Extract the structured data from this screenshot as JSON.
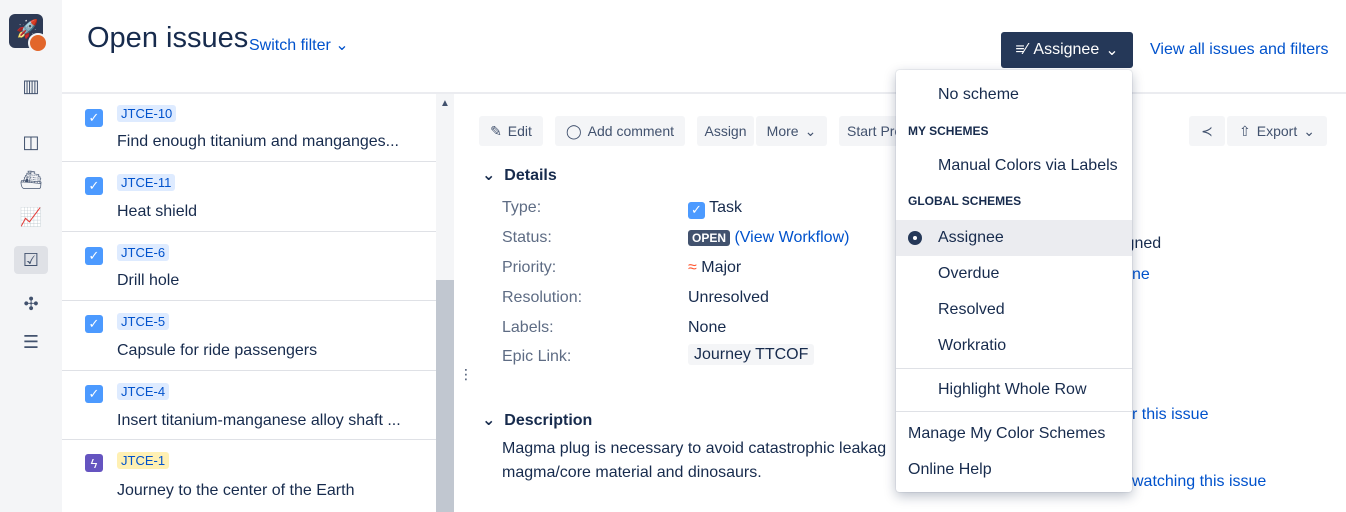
{
  "header": {
    "title": "Open issues",
    "switch_filter": "Switch filter",
    "assignee_button": "Assignee",
    "view_all": "View all issues and filters"
  },
  "nav": {
    "icons": [
      "app-logo-icon",
      "board-icon",
      "columns-icon",
      "ship-icon",
      "chart-icon",
      "issues-icon",
      "puzzle-icon",
      "checklist-icon"
    ]
  },
  "issues": [
    {
      "key": "JTCE-10",
      "summary": "Find enough titanium and manganges...",
      "type": "task"
    },
    {
      "key": "JTCE-11",
      "summary": "Heat shield",
      "type": "task"
    },
    {
      "key": "JTCE-6",
      "summary": "Drill hole",
      "type": "task"
    },
    {
      "key": "JTCE-5",
      "summary": "Capsule for ride passengers",
      "type": "task"
    },
    {
      "key": "JTCE-4",
      "summary": "Insert titanium-manganese alloy shaft ...",
      "type": "task"
    },
    {
      "key": "JTCE-1",
      "summary": "Journey to the center of the Earth",
      "type": "epic"
    }
  ],
  "toolbar": {
    "edit": "Edit",
    "add_comment": "Add comment",
    "assign": "Assign",
    "more": "More",
    "start_progress": "Start Pro",
    "export": "Export"
  },
  "details": {
    "heading": "Details",
    "type_label": "Type:",
    "type_value": "Task",
    "status_label": "Status:",
    "status_value": "OPEN",
    "view_workflow": "(View Workflow)",
    "priority_label": "Priority:",
    "priority_value": "Major",
    "resolution_label": "Resolution:",
    "resolution_value": "Unresolved",
    "labels_label": "Labels:",
    "labels_value": "None",
    "epic_label": "Epic Link:",
    "epic_value": "Journey TTCOF"
  },
  "description": {
    "heading": "Description",
    "line1": "Magma plug is necessary to avoid catastrophic leakag",
    "line2": "magma/core material and dinosaurs."
  },
  "peek": {
    "assigned": "igned",
    "me": "ne",
    "for_issue": "r this issue",
    "watching": "watching this issue"
  },
  "dropdown": {
    "no_scheme": "No scheme",
    "my_schemes": "MY SCHEMES",
    "manual_colors": "Manual Colors via Labels",
    "global_schemes": "GLOBAL SCHEMES",
    "assignee": "Assignee",
    "overdue": "Overdue",
    "resolved": "Resolved",
    "workratio": "Workratio",
    "highlight_row": "Highlight Whole Row",
    "manage": "Manage My Color Schemes",
    "online_help": "Online Help"
  },
  "colors": {
    "accent": "#0052cc",
    "dark_button": "#253858",
    "key_badge": "#deebff",
    "epic_key_badge": "#fff0b3"
  }
}
